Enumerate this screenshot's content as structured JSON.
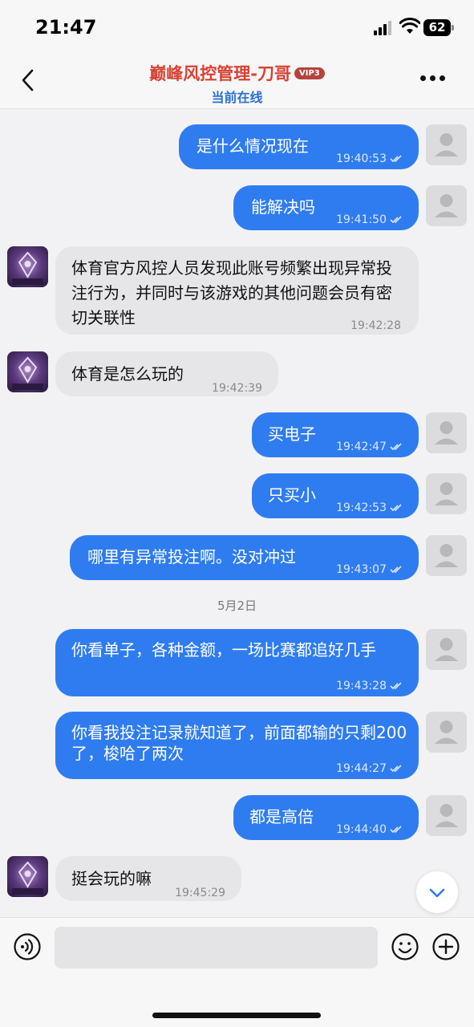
{
  "status_bar": {
    "time": "21:47",
    "battery": "62"
  },
  "header": {
    "title": "巅峰风控管理-刀哥",
    "badge": "VIP3",
    "subtitle": "当前在线"
  },
  "messages": [
    {
      "dir": "out",
      "text": "是什么情况现在",
      "time": "19:40:53"
    },
    {
      "dir": "out",
      "text": "能解决吗",
      "time": "19:41:50"
    },
    {
      "dir": "in",
      "text": "体育官方风控人员发现此账号频繁出现异常投注行为，并同时与该游戏的其他问题会员有密切关联性",
      "time": "19:42:28"
    },
    {
      "dir": "in",
      "text": "体育是怎么玩的",
      "time": "19:42:39"
    },
    {
      "dir": "out",
      "text": "买电子",
      "time": "19:42:47"
    },
    {
      "dir": "out",
      "text": "只买小",
      "time": "19:42:53"
    },
    {
      "dir": "out",
      "text": "哪里有异常投注啊。没对冲过",
      "time": "19:43:07"
    },
    {
      "dir": "out",
      "text": "你看单子，各种金额，一场比赛都追好几手",
      "time": "19:43:28"
    },
    {
      "dir": "out",
      "text": "你看我投注记录就知道了，前面都输的只剩200了，梭哈了两次",
      "time": "19:44:27"
    },
    {
      "dir": "out",
      "text": "都是高倍",
      "time": "19:44:40"
    },
    {
      "dir": "in",
      "text": "挺会玩的嘛",
      "time": "19:45:29"
    }
  ],
  "date_separator": "5月2日",
  "input": {
    "placeholder": ""
  },
  "icons": {
    "back": "chevron-left-icon",
    "more": "more-horizontal-icon",
    "voice": "voice-icon",
    "emoji": "emoji-icon",
    "plus": "plus-icon",
    "scroll": "chevron-down-icon"
  },
  "colors": {
    "outgoing_bubble": "#2f7cf0",
    "incoming_bubble": "#e6e6e9",
    "title": "#d74133",
    "online": "#2b6fd4"
  }
}
